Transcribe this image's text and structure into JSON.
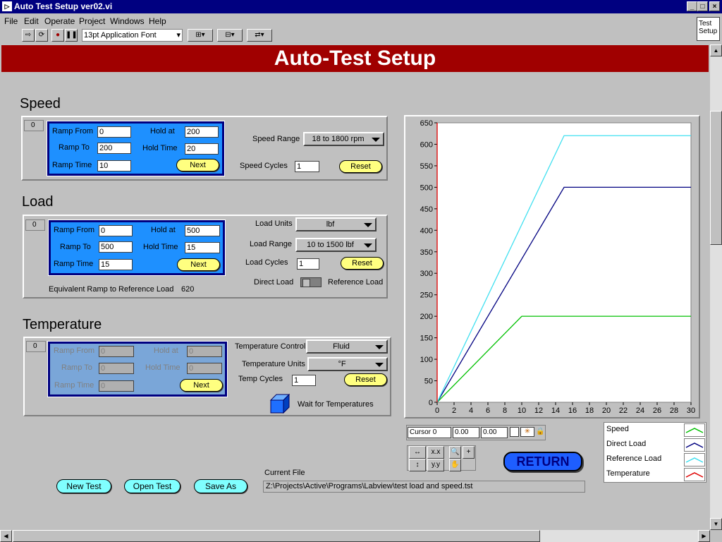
{
  "window": {
    "title": "Auto Test Setup ver02.vi",
    "test_setup_label": "Test Setup"
  },
  "menu": [
    "File",
    "Edit",
    "Operate",
    "Project",
    "Windows",
    "Help"
  ],
  "toolbar": {
    "font": "13pt Application Font"
  },
  "banner": "Auto-Test Setup",
  "speed": {
    "title": "Speed",
    "index": "0",
    "ramp_from_label": "Ramp From",
    "ramp_from": "0",
    "ramp_to_label": "Ramp To",
    "ramp_to": "200",
    "ramp_time_label": "Ramp Time",
    "ramp_time": "10",
    "hold_at_label": "Hold at",
    "hold_at": "200",
    "hold_time_label": "Hold Time",
    "hold_time": "20",
    "next_label": "Next",
    "range_label": "Speed Range",
    "range_value": "18 to 1800 rpm",
    "cycles_label": "Speed Cycles",
    "cycles": "1",
    "reset_label": "Reset"
  },
  "load": {
    "title": "Load",
    "index": "0",
    "ramp_from_label": "Ramp From",
    "ramp_from": "0",
    "ramp_to_label": "Ramp To",
    "ramp_to": "500",
    "ramp_time_label": "Ramp Time",
    "ramp_time": "15",
    "hold_at_label": "Hold at",
    "hold_at": "500",
    "hold_time_label": "Hold Time",
    "hold_time": "15",
    "next_label": "Next",
    "units_label": "Load Units",
    "units_value": "lbf",
    "range_label": "Load Range",
    "range_value": "10 to 1500 lbf",
    "cycles_label": "Load Cycles",
    "cycles": "1",
    "reset_label": "Reset",
    "equiv_label": "Equivalent Ramp to Reference Load",
    "equiv_value": "620",
    "direct_label": "Direct Load",
    "reference_label": "Reference Load"
  },
  "temperature": {
    "title": "Temperature",
    "index": "0",
    "ramp_from_label": "Ramp From",
    "ramp_from": "0",
    "ramp_to_label": "Ramp To",
    "ramp_to": "0",
    "ramp_time_label": "Ramp Time",
    "ramp_time": "0",
    "hold_at_label": "Hold at",
    "hold_at": "0",
    "hold_time_label": "Hold Time",
    "hold_time": "0",
    "next_label": "Next",
    "control_label": "Temperature Control",
    "control_value": "Fluid",
    "units_label": "Temperature Units",
    "units_value": "°F",
    "cycles_label": "Temp Cycles",
    "cycles": "1",
    "reset_label": "Reset",
    "wait_label": "Wait for Temperatures"
  },
  "cursor": {
    "name": "Cursor 0",
    "x": "0.00",
    "y": "0.00"
  },
  "return_label": "RETURN",
  "buttons": {
    "new_test": "New Test",
    "open_test": "Open Test",
    "save_as": "Save As"
  },
  "current_file": {
    "label": "Current File",
    "path": "Z:\\Projects\\Active\\Programs\\Labview\\test load and speed.tst"
  },
  "colors": {
    "speed": "#00c000",
    "direct": "#000080",
    "reference": "#40e0f0",
    "temperature": "#e00000",
    "banner": "#a00000"
  },
  "chart_data": {
    "type": "line",
    "xlim": [
      0,
      30
    ],
    "ylim": [
      0,
      650
    ],
    "xticks": [
      0,
      2,
      4,
      6,
      8,
      10,
      12,
      14,
      16,
      18,
      20,
      22,
      24,
      26,
      28,
      30
    ],
    "yticks": [
      0,
      50,
      100,
      150,
      200,
      250,
      300,
      350,
      400,
      450,
      500,
      550,
      600,
      650
    ],
    "series": [
      {
        "name": "Speed",
        "x": [
          0,
          10,
          30
        ],
        "y": [
          0,
          200,
          200
        ]
      },
      {
        "name": "Direct Load",
        "x": [
          0,
          15,
          30
        ],
        "y": [
          0,
          500,
          500
        ]
      },
      {
        "name": "Reference Load",
        "x": [
          0,
          15,
          30
        ],
        "y": [
          0,
          620,
          620
        ]
      },
      {
        "name": "Temperature",
        "x": [
          0,
          0
        ],
        "y": [
          0,
          650
        ]
      }
    ]
  }
}
